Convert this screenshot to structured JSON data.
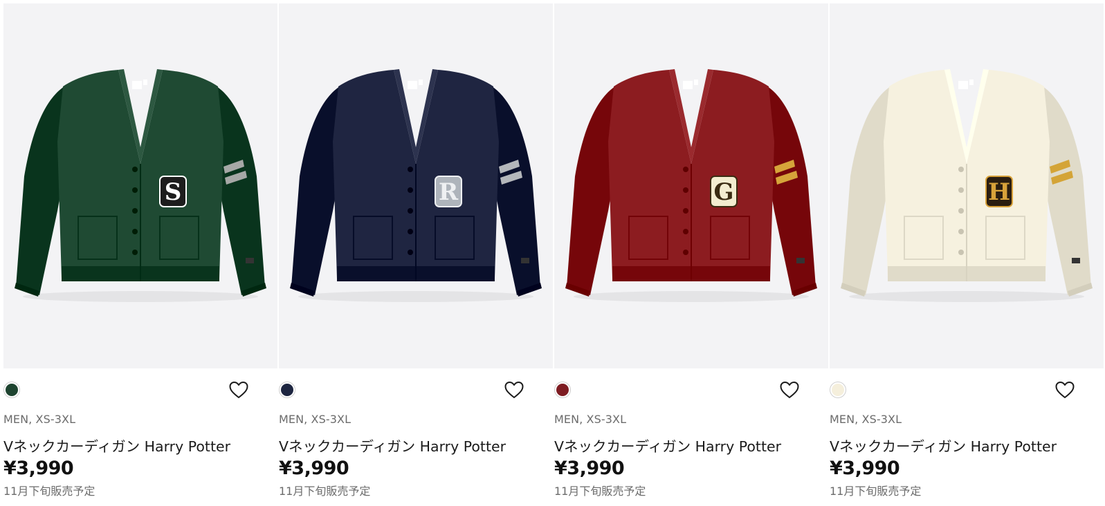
{
  "products": [
    {
      "gender_size": "MEN, XS-3XL",
      "name": "Vネックカーディガン Harry Potter",
      "price": "¥3,990",
      "note": "11月下旬販売予定",
      "patch_letter": "S",
      "color_hex": "#1f4a33",
      "swatch_color": "#1e4430",
      "stripe_color": "#a6a8a6",
      "patch_fill": "#1d1d1d",
      "patch_text": "#ffffff",
      "image_icon": "cardigan-green-image"
    },
    {
      "gender_size": "MEN, XS-3XL",
      "name": "Vネックカーディガン Harry Potter",
      "price": "¥3,990",
      "note": "11月下旬販売予定",
      "patch_letter": "R",
      "color_hex": "#1f2541",
      "swatch_color": "#1d2540",
      "stripe_color": "#b4b7bb",
      "patch_fill": "#aeb4bb",
      "patch_text": "#eef0f2",
      "image_icon": "cardigan-navy-image"
    },
    {
      "gender_size": "MEN, XS-3XL",
      "name": "Vネックカーディガン Harry Potter",
      "price": "¥3,990",
      "note": "11月下旬販売予定",
      "patch_letter": "G",
      "color_hex": "#8c1c20",
      "swatch_color": "#7e1c22",
      "stripe_color": "#d6a43a",
      "patch_fill": "#f3ecd0",
      "patch_text": "#3a2b12",
      "image_icon": "cardigan-red-image"
    },
    {
      "gender_size": "MEN, XS-3XL",
      "name": "Vネックカーディガン Harry Potter",
      "price": "¥3,990",
      "note": "11月下旬販売予定",
      "patch_letter": "H",
      "color_hex": "#f6f1df",
      "swatch_color": "#f5efdc",
      "stripe_color": "#d4a437",
      "patch_fill": "#2a1d10",
      "patch_text": "#d8a23a",
      "image_icon": "cardigan-cream-image"
    }
  ],
  "icons": {
    "favorite": "heart-outline-icon"
  }
}
